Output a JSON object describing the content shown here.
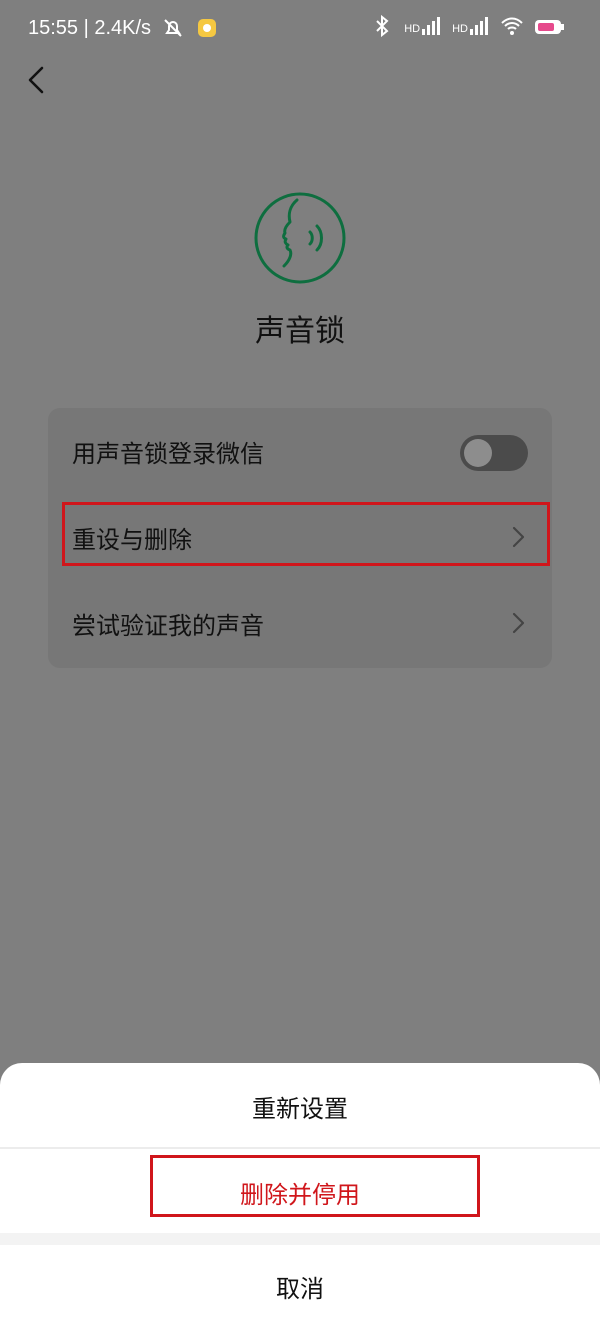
{
  "status": {
    "time_speed": "15:55 | 2.4K/s",
    "net1": "HD",
    "net2": "HD"
  },
  "page": {
    "title": "声音锁"
  },
  "settings": {
    "rows": [
      {
        "label": "用声音锁登录微信",
        "toggle_on": false
      },
      {
        "label": "重设与删除"
      },
      {
        "label": "尝试验证我的声音"
      }
    ]
  },
  "sheet": {
    "reset_label": "重新设置",
    "delete_label": "删除并停用",
    "cancel_label": "取消"
  },
  "colors": {
    "accent_green": "#0e6e3f",
    "danger_red": "#d0161b"
  },
  "icons": {
    "back": "chevron-left-icon",
    "hero": "voice-face-icon",
    "chevron": "chevron-right-icon"
  }
}
